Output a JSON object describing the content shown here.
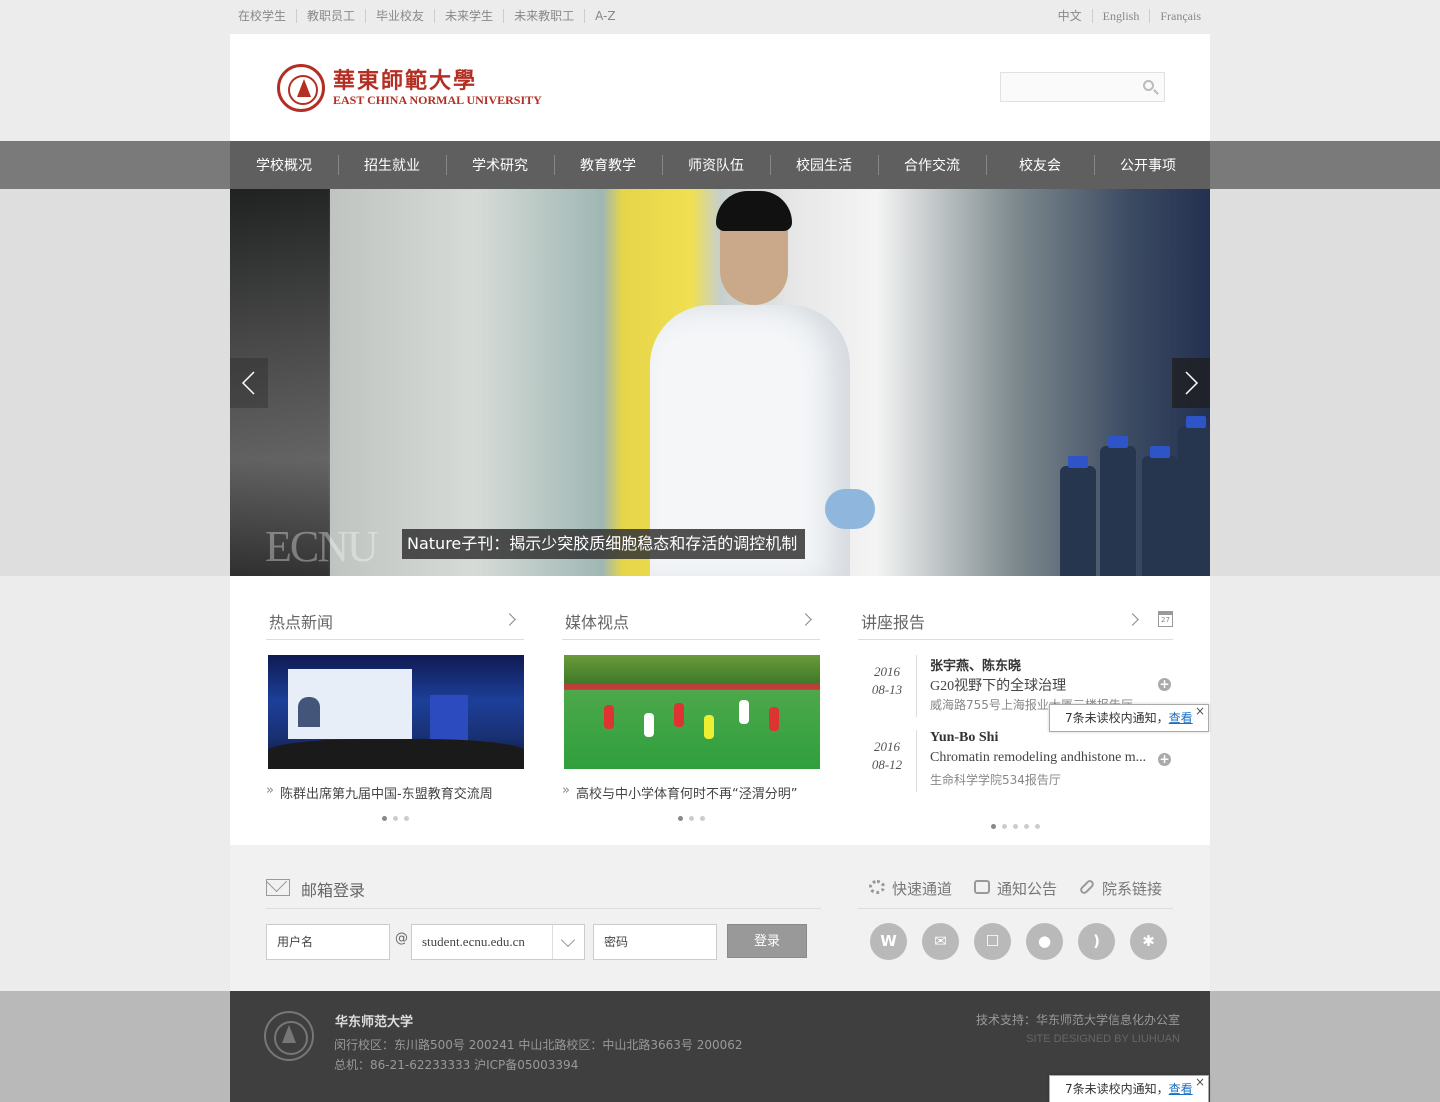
{
  "topbar": {
    "links": [
      "在校学生",
      "教职员工",
      "毕业校友",
      "未来学生",
      "未来教职工",
      "A-Z"
    ],
    "langs": [
      "中文",
      "English",
      "Français"
    ]
  },
  "header": {
    "logo_cn": "華東師範大學",
    "logo_en": "EAST CHINA NORMAL UNIVERSITY",
    "search_placeholder": ""
  },
  "nav": {
    "items": [
      "学校概况",
      "招生就业",
      "学术研究",
      "教育教学",
      "师资队伍",
      "校园生活",
      "合作交流",
      "校友会",
      "公开事项"
    ]
  },
  "banner": {
    "watermark": "ECNU",
    "caption": "Nature子刊：揭示少突胶质细胞稳态和存活的调控机制"
  },
  "news": {
    "title": "热点新闻",
    "headline": "陈群出席第九届中国-东盟教育交流周"
  },
  "media": {
    "title": "媒体视点",
    "headline": "高校与中小学体育何时不再“泾渭分明”"
  },
  "lectures": {
    "title": "讲座报告",
    "calendar_day": "27",
    "items": [
      {
        "year": "2016",
        "date": "08-13",
        "speaker": "张宇燕、陈东晓",
        "topic": "G20视野下的全球治理",
        "place": "威海路755号上海报业大厦三楼报告厅"
      },
      {
        "year": "2016",
        "date": "08-12",
        "speaker": "Yun-Bo Shi",
        "topic": "Chromatin remodeling andhistone m...",
        "place": "生命科学学院534报告厅"
      }
    ]
  },
  "toast": {
    "text": "7条未读校内通知，",
    "link": "查看",
    "close": "×"
  },
  "mail": {
    "title": "邮箱登录",
    "username_placeholder": "用户名",
    "at": "@",
    "domain": "student.ecnu.edu.cn",
    "password_placeholder": "密码",
    "login": "登录"
  },
  "quick": {
    "items": [
      "快速通道",
      "通知公告",
      "院系链接"
    ]
  },
  "socials": [
    "weibo",
    "wechat",
    "mobile",
    "apple",
    "rss",
    "settings"
  ],
  "footer": {
    "name": "华东师范大学",
    "address1": "闵行校区：东川路500号 200241  中山北路校区：中山北路3663号 200062",
    "address2": "总机：86-21-62233333  沪ICP备05003394",
    "tech": "技术支持：华东师范大学信息化办公室",
    "design": "SITE DESIGNED BY LIUHUAN"
  }
}
